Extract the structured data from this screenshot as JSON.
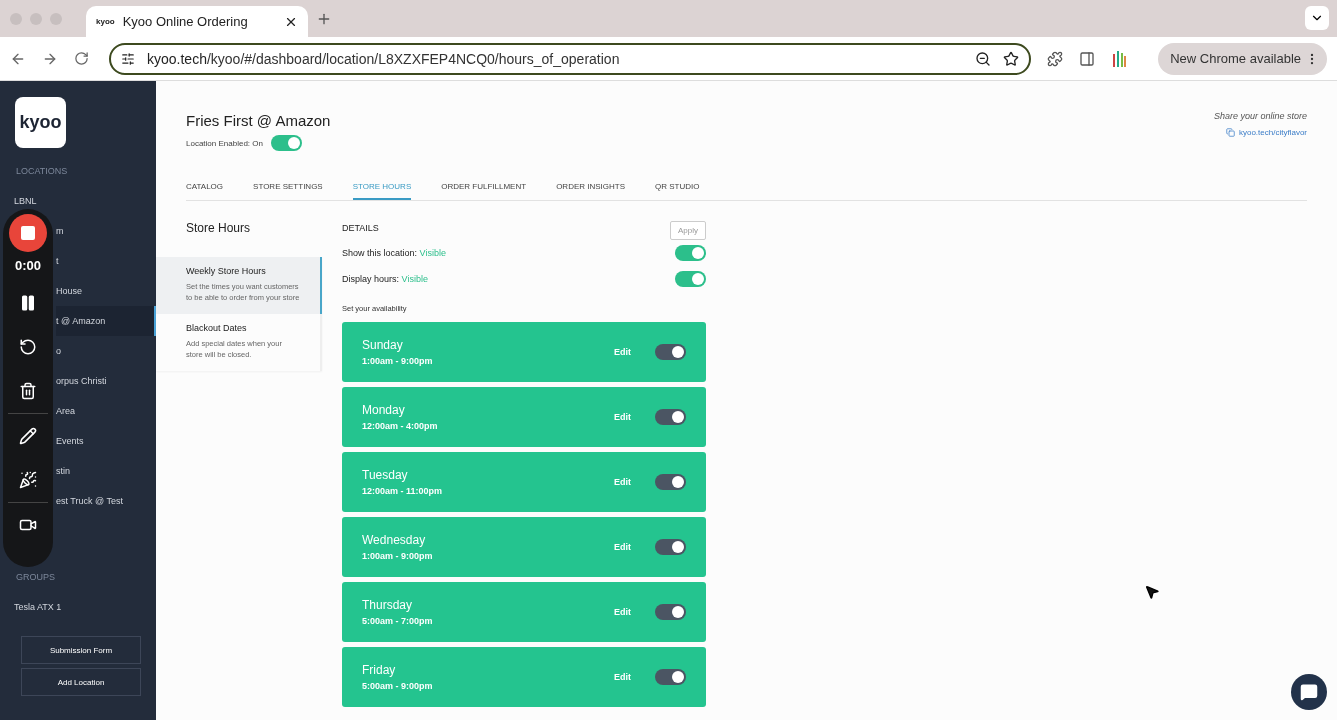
{
  "browser": {
    "favicon_text": "kyoo",
    "tab_title": "Kyoo Online Ordering",
    "url_host": "kyoo.tech",
    "url_path": "/kyoo/#/dashboard/location/L8XZXFEP4NCQ0/hours_of_operation",
    "update_button": "New Chrome available"
  },
  "sidebar": {
    "logo": "kyoo",
    "locations_heading": "LOCATIONS",
    "locations": [
      {
        "label": "LBNL",
        "selected": false,
        "partly_hidden": false
      },
      {
        "label": "m",
        "selected": false,
        "partly_hidden": true
      },
      {
        "label": "t",
        "selected": false,
        "partly_hidden": true
      },
      {
        "label": "House",
        "selected": false,
        "partly_hidden": true
      },
      {
        "label": "t @ Amazon",
        "selected": true,
        "partly_hidden": true
      },
      {
        "label": "o",
        "selected": false,
        "partly_hidden": true
      },
      {
        "label": "orpus Christi",
        "selected": false,
        "partly_hidden": true
      },
      {
        "label": "Area",
        "selected": false,
        "partly_hidden": true
      },
      {
        "label": "Events",
        "selected": false,
        "partly_hidden": true
      },
      {
        "label": "stin",
        "selected": false,
        "partly_hidden": true
      },
      {
        "label": "est Truck @ Test",
        "selected": false,
        "partly_hidden": true
      }
    ],
    "groups_heading": "GROUPS",
    "groups": [
      {
        "label": "Tesla ATX 1"
      }
    ],
    "buttons": [
      "Submission Form",
      "Add Location"
    ]
  },
  "recorder": {
    "timer": "0:00"
  },
  "header": {
    "title": "Fries First @ Amazon",
    "enabled_label": "Location Enabled: On",
    "enabled": true,
    "share_label": "Share your online store",
    "share_link": "kyoo.tech/cityflavor"
  },
  "tabs": [
    {
      "label": "CATALOG",
      "selected": false
    },
    {
      "label": "STORE SETTINGS",
      "selected": false
    },
    {
      "label": "STORE HOURS",
      "selected": true
    },
    {
      "label": "ORDER FULFILLMENT",
      "selected": false
    },
    {
      "label": "ORDER INSIGHTS",
      "selected": false
    },
    {
      "label": "QR STUDIO",
      "selected": false
    }
  ],
  "store_hours": {
    "heading": "Store Hours",
    "menu": [
      {
        "title": "Weekly Store Hours",
        "description": "Set the times you want customers to be able to order from your store",
        "selected": true
      },
      {
        "title": "Blackout Dates",
        "description": "Add special dates when your store will be closed.",
        "selected": false
      }
    ]
  },
  "details": {
    "heading": "DETAILS",
    "apply_button": "Apply",
    "settings": [
      {
        "label": "Show this location:",
        "value": "Visible",
        "on": true
      },
      {
        "label": "Display hours:",
        "value": "Visible",
        "on": true
      }
    ],
    "availability_label": "Set your availability",
    "days": [
      {
        "day": "Sunday",
        "hours": "1:00am - 9:00pm",
        "edit": "Edit",
        "on": true
      },
      {
        "day": "Monday",
        "hours": "12:00am - 4:00pm",
        "edit": "Edit",
        "on": true
      },
      {
        "day": "Tuesday",
        "hours": "12:00am - 11:00pm",
        "edit": "Edit",
        "on": true
      },
      {
        "day": "Wednesday",
        "hours": "1:00am - 9:00pm",
        "edit": "Edit",
        "on": true
      },
      {
        "day": "Thursday",
        "hours": "5:00am - 7:00pm",
        "edit": "Edit",
        "on": true
      },
      {
        "day": "Friday",
        "hours": "5:00am - 9:00pm",
        "edit": "Edit",
        "on": true
      }
    ]
  }
}
